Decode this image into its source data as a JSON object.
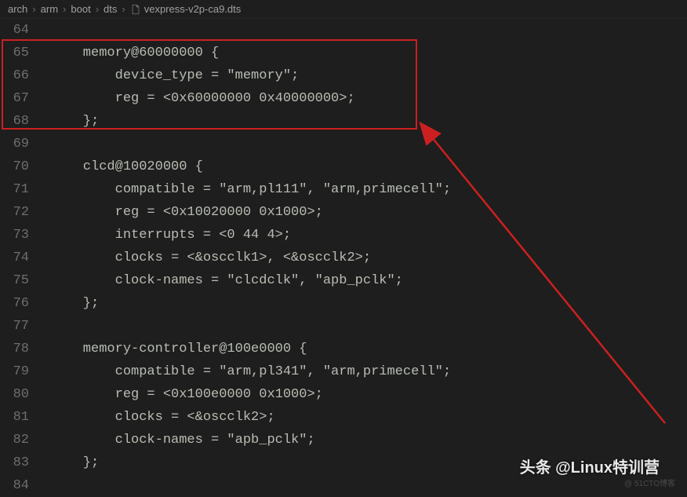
{
  "breadcrumb": {
    "parts": [
      "arch",
      "arm",
      "boot",
      "dts",
      "vexpress-v2p-ca9.dts"
    ],
    "separator": "›"
  },
  "editor": {
    "startLine": 64,
    "lines": [
      "",
      "    memory@60000000 {",
      "        device_type = \"memory\";",
      "        reg = <0x60000000 0x40000000>;",
      "    };",
      "",
      "    clcd@10020000 {",
      "        compatible = \"arm,pl111\", \"arm,primecell\";",
      "        reg = <0x10020000 0x1000>;",
      "        interrupts = <0 44 4>;",
      "        clocks = <&oscclk1>, <&oscclk2>;",
      "        clock-names = \"clcdclk\", \"apb_pclk\";",
      "    };",
      "",
      "    memory-controller@100e0000 {",
      "        compatible = \"arm,pl341\", \"arm,primecell\";",
      "        reg = <0x100e0000 0x1000>;",
      "        clocks = <&oscclk2>;",
      "        clock-names = \"apb_pclk\";",
      "    };",
      ""
    ]
  },
  "watermark": {
    "main": "头条 @Linux特训营",
    "sub": "@ 51CTO博客"
  }
}
